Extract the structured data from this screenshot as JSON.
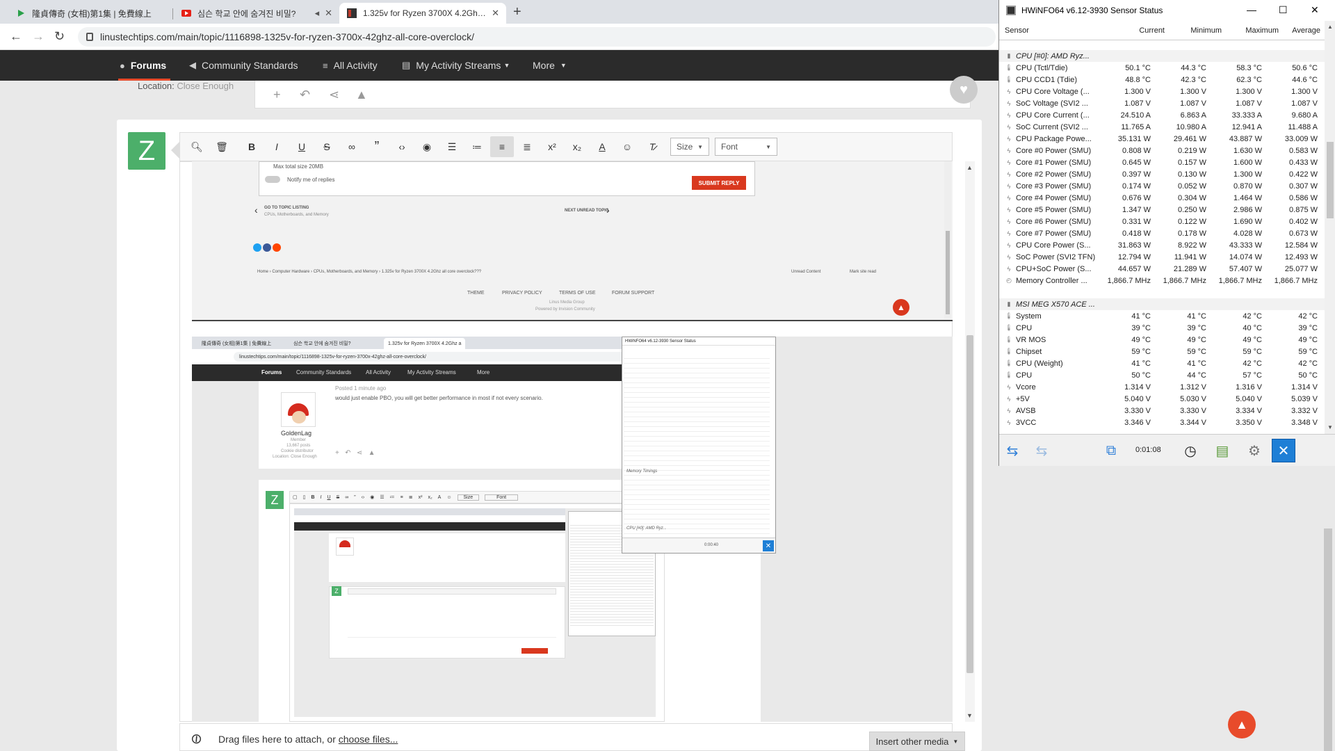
{
  "browser": {
    "tabs": [
      {
        "title": "隆貞傳奇 (女相)第1集 | 免費線上",
        "icon": "play-icon"
      },
      {
        "title": "심슨 학교 안에 숨겨진 비밀?",
        "icon": "youtube-icon"
      },
      {
        "title": "1.325v for Ryzen 3700X 4.2Ghz a",
        "icon": "ltt-icon"
      }
    ],
    "url": "linustechtips.com/main/topic/1116898-1325v-for-ryzen-3700x-42ghz-all-core-overclock/"
  },
  "site_nav": {
    "items": [
      "Forums",
      "Community Standards",
      "All Activity",
      "My Activity Streams",
      "More"
    ]
  },
  "previous_post": {
    "location_label": "Location:",
    "location_value": "Close Enough"
  },
  "reply": {
    "avatar_letter": "Z",
    "toolbar": {
      "size_label": "Size",
      "font_label": "Font"
    },
    "drop_text": "Drag files here to attach, or",
    "drop_link": "choose files...",
    "insert_media": "Insert other media"
  },
  "embedded_1": {
    "max_size": "Max total size 20MB",
    "notify": "Notify me of replies",
    "submit": "SUBMIT REPLY",
    "go_to_topic": "GO TO TOPIC LISTING",
    "go_to_topic_sub": "CPUs, Motherboards, and Memory",
    "next_topic": "NEXT UNREAD TOPIC",
    "breadcrumb": "Home  ›  Computer Hardware  ›  CPUs, Motherboards, and Memory  ›  1.325v for Ryzen 3700X 4.2Ghz all core overclock???",
    "unread": "Unread Content",
    "mark_read": "Mark site read",
    "footer_links": [
      "THEME",
      "PRIVACY POLICY",
      "TERMS OF USE",
      "FORUM SUPPORT"
    ],
    "footer_line1": "Linus Media Group",
    "footer_line2": "Powered by Invision Community"
  },
  "embedded_2": {
    "tabs": [
      "隆貞傳奇 (女相)第1集 | 免費線上",
      "심슨 학교 안에 숨겨진 비밀?",
      "1.325v for Ryzen 3700X 4.2Ghz a"
    ],
    "url": "linustechtips.com/main/topic/1116898-1325v-for-ryzen-3700x-42ghz-all-core-overclock/",
    "nav": [
      "Forums",
      "Community Standards",
      "All Activity",
      "My Activity Streams",
      "More"
    ],
    "posted": "Posted 1 minute ago",
    "post_text": "would just enable PBO, you will get better performance in most if not every scenario.",
    "username": "GoldenLag",
    "role": "Member",
    "posts": "13,667 posts",
    "title": "Cookie distributor",
    "location": "Location: Close Enough",
    "hw_title": "HWiNFO64 v6.12-3930 Sensor Status",
    "hw_timer": "0:00:40",
    "hw_groups": [
      "Memory Timings",
      "CPU [#0]: AMD Ryz..."
    ]
  },
  "hwinfo": {
    "title": "HWiNFO64 v6.12-3930 Sensor Status",
    "columns": [
      "Sensor",
      "Current",
      "Minimum",
      "Maximum",
      "Average"
    ],
    "timer": "0:01:08",
    "groups": [
      {
        "name": "CPU [#0]: AMD Ryz...",
        "rows": [
          {
            "icon": "thermometer-icon",
            "name": "CPU (Tctl/Tdie)",
            "cur": "50.1 °C",
            "min": "44.3 °C",
            "max": "58.3 °C",
            "avg": "50.6 °C"
          },
          {
            "icon": "thermometer-icon",
            "name": "CPU CCD1 (Tdie)",
            "cur": "48.8 °C",
            "min": "42.3 °C",
            "max": "62.3 °C",
            "avg": "44.6 °C"
          },
          {
            "icon": "bolt-icon",
            "name": "CPU Core Voltage (...",
            "cur": "1.300 V",
            "min": "1.300 V",
            "max": "1.300 V",
            "avg": "1.300 V"
          },
          {
            "icon": "bolt-icon",
            "name": "SoC Voltage (SVI2 ...",
            "cur": "1.087 V",
            "min": "1.087 V",
            "max": "1.087 V",
            "avg": "1.087 V"
          },
          {
            "icon": "bolt-icon",
            "name": "CPU Core Current (...",
            "cur": "24.510 A",
            "min": "6.863 A",
            "max": "33.333 A",
            "avg": "9.680 A"
          },
          {
            "icon": "bolt-icon",
            "name": "SoC Current (SVI2 ...",
            "cur": "11.765 A",
            "min": "10.980 A",
            "max": "12.941 A",
            "avg": "11.488 A"
          },
          {
            "icon": "bolt-icon",
            "name": "CPU Package Powe...",
            "cur": "35.131 W",
            "min": "29.461 W",
            "max": "43.887 W",
            "avg": "33.009 W"
          },
          {
            "icon": "bolt-icon",
            "name": "Core #0 Power (SMU)",
            "cur": "0.808 W",
            "min": "0.219 W",
            "max": "1.630 W",
            "avg": "0.583 W"
          },
          {
            "icon": "bolt-icon",
            "name": "Core #1 Power (SMU)",
            "cur": "0.645 W",
            "min": "0.157 W",
            "max": "1.600 W",
            "avg": "0.433 W"
          },
          {
            "icon": "bolt-icon",
            "name": "Core #2 Power (SMU)",
            "cur": "0.397 W",
            "min": "0.130 W",
            "max": "1.300 W",
            "avg": "0.422 W"
          },
          {
            "icon": "bolt-icon",
            "name": "Core #3 Power (SMU)",
            "cur": "0.174 W",
            "min": "0.052 W",
            "max": "0.870 W",
            "avg": "0.307 W"
          },
          {
            "icon": "bolt-icon",
            "name": "Core #4 Power (SMU)",
            "cur": "0.676 W",
            "min": "0.304 W",
            "max": "1.464 W",
            "avg": "0.586 W"
          },
          {
            "icon": "bolt-icon",
            "name": "Core #5 Power (SMU)",
            "cur": "1.347 W",
            "min": "0.250 W",
            "max": "2.986 W",
            "avg": "0.875 W"
          },
          {
            "icon": "bolt-icon",
            "name": "Core #6 Power (SMU)",
            "cur": "0.331 W",
            "min": "0.122 W",
            "max": "1.690 W",
            "avg": "0.402 W"
          },
          {
            "icon": "bolt-icon",
            "name": "Core #7 Power (SMU)",
            "cur": "0.418 W",
            "min": "0.178 W",
            "max": "4.028 W",
            "avg": "0.673 W"
          },
          {
            "icon": "bolt-icon",
            "name": "CPU Core Power (S...",
            "cur": "31.863 W",
            "min": "8.922 W",
            "max": "43.333 W",
            "avg": "12.584 W"
          },
          {
            "icon": "bolt-icon",
            "name": "SoC Power (SVI2 TFN)",
            "cur": "12.794 W",
            "min": "11.941 W",
            "max": "14.074 W",
            "avg": "12.493 W"
          },
          {
            "icon": "bolt-icon",
            "name": "CPU+SoC Power (S...",
            "cur": "44.657 W",
            "min": "21.289 W",
            "max": "57.407 W",
            "avg": "25.077 W"
          },
          {
            "icon": "clock-icon",
            "name": "Memory Controller ...",
            "cur": "1,866.7 MHz",
            "min": "1,866.7 MHz",
            "max": "1,866.7 MHz",
            "avg": "1,866.7 MHz"
          }
        ]
      },
      {
        "name": "MSI MEG X570 ACE ...",
        "rows": [
          {
            "icon": "thermometer-icon",
            "name": "System",
            "cur": "41 °C",
            "min": "41 °C",
            "max": "42 °C",
            "avg": "42 °C"
          },
          {
            "icon": "thermometer-icon",
            "name": "CPU",
            "cur": "39 °C",
            "min": "39 °C",
            "max": "40 °C",
            "avg": "39 °C"
          },
          {
            "icon": "thermometer-icon",
            "name": "VR MOS",
            "cur": "49 °C",
            "min": "49 °C",
            "max": "49 °C",
            "avg": "49 °C"
          },
          {
            "icon": "thermometer-icon",
            "name": "Chipset",
            "cur": "59 °C",
            "min": "59 °C",
            "max": "59 °C",
            "avg": "59 °C"
          },
          {
            "icon": "thermometer-icon",
            "name": "CPU (Weight)",
            "cur": "41 °C",
            "min": "41 °C",
            "max": "42 °C",
            "avg": "42 °C"
          },
          {
            "icon": "thermometer-icon",
            "name": "CPU",
            "cur": "50 °C",
            "min": "44 °C",
            "max": "57 °C",
            "avg": "50 °C"
          },
          {
            "icon": "bolt-icon",
            "name": "Vcore",
            "cur": "1.314 V",
            "min": "1.312 V",
            "max": "1.316 V",
            "avg": "1.314 V"
          },
          {
            "icon": "bolt-icon",
            "name": "+5V",
            "cur": "5.040 V",
            "min": "5.030 V",
            "max": "5.040 V",
            "avg": "5.039 V"
          },
          {
            "icon": "bolt-icon",
            "name": "AVSB",
            "cur": "3.330 V",
            "min": "3.330 V",
            "max": "3.334 V",
            "avg": "3.332 V"
          },
          {
            "icon": "bolt-icon",
            "name": "3VCC",
            "cur": "3.346 V",
            "min": "3.344 V",
            "max": "3.350 V",
            "avg": "3.348 V"
          }
        ]
      }
    ],
    "colors": {
      "accent": "#e84b2b",
      "avatar": "#4caf6a",
      "close": "#1e7fd6"
    }
  }
}
